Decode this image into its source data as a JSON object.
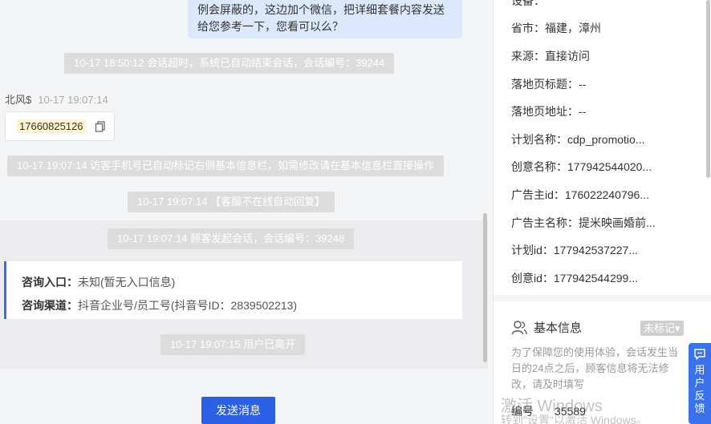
{
  "chat": {
    "agent_message": "例会屏蔽的，这边加个微信，把详细套餐内容发送给您参考一下，您看可以么？",
    "sys_timeout": "10-17 18:50:12 会话超时，系统已自动结束会话，会话编号：39244",
    "sender_name": "北风$",
    "sender_time": "10-17 19:07:14",
    "phone_number": "17660825126",
    "sys_phone_marked": "10-17 19:07:14 访客手机号已自动标记右侧基本信息栏，如需修改请在基本信息栏直接操作",
    "sys_auto_reply": "10-17 19:07:14 【客服不在线自动回复】",
    "sys_new_session": "10-17 19:07:14 顾客发起会话，会话编号：39248",
    "info_entry_label": "咨询入口：",
    "info_entry_value": "未知(暂无入口信息)",
    "info_channel_label": "咨询渠道：",
    "info_channel_value": "抖音企业号/员工号(抖音号ID：2839502213)",
    "sys_user_left": "10-17 19:07:15 用户已离开",
    "send_label": "发送消息"
  },
  "panel": {
    "device_partial": "设备：",
    "province": "省市：福建，漳州",
    "source": "来源：直接访问",
    "landing_title": "落地页标题：--",
    "landing_url": "落地页地址：--",
    "plan_name": "计划名称：cdp_promotio...",
    "creative_name": "创意名称：177942544020...",
    "advertiser_id": "广告主id：176022240796...",
    "advertiser_name": "广告主名称：提米映画婚前...",
    "plan_id": "计划id：177942537227...",
    "creative_id": "创意id：177942544299...",
    "basic_info_title": "基本信息",
    "tag_label": "未标记▾",
    "notice": "为了保障您的使用体验，会话发生当日的24点之后，顾客信息将无法修改，请及时填写",
    "number_label": "编号",
    "number_value": "35589"
  },
  "watermark": {
    "line1": "激活 Windows",
    "line2": "转到\"设置\"以激活 Windows。"
  },
  "feedback_label": "用户反馈"
}
